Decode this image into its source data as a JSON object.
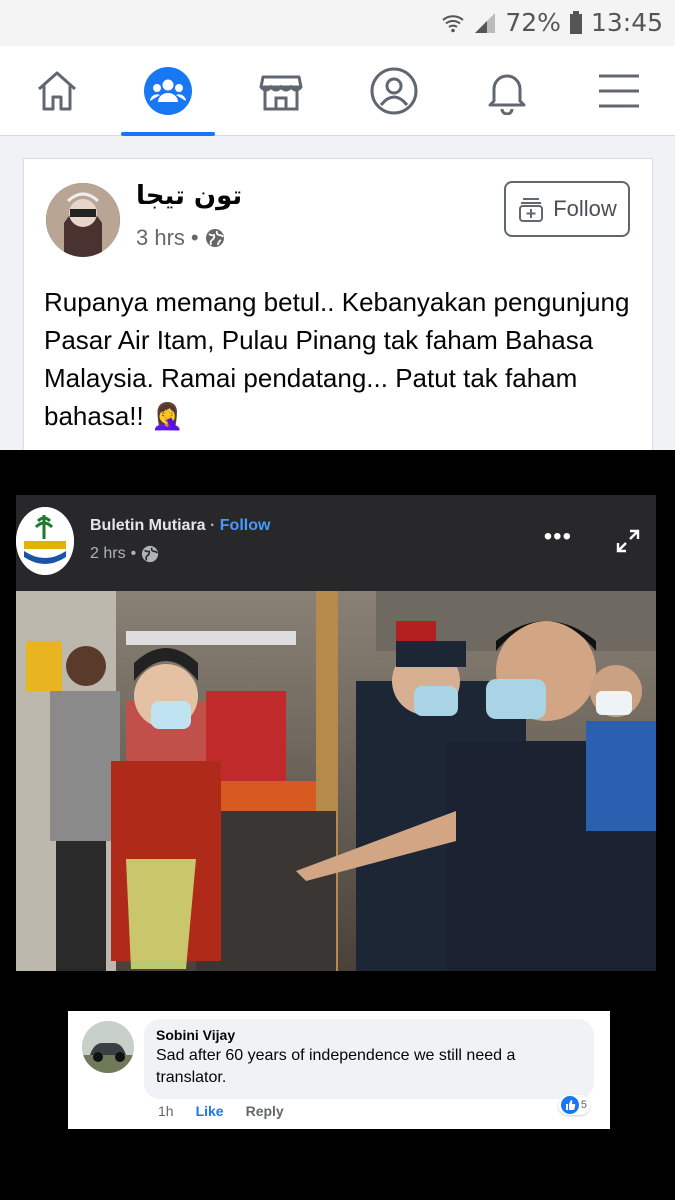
{
  "status_bar": {
    "battery": "72%",
    "time": "13:45"
  },
  "nav": {
    "items": [
      {
        "name": "home",
        "icon": "home-icon"
      },
      {
        "name": "groups",
        "icon": "groups-icon",
        "active": true
      },
      {
        "name": "marketplace",
        "icon": "marketplace-icon"
      },
      {
        "name": "profile",
        "icon": "profile-icon"
      },
      {
        "name": "notifications",
        "icon": "bell-icon"
      },
      {
        "name": "menu",
        "icon": "menu-icon"
      }
    ],
    "accent": "#1877f2"
  },
  "post": {
    "author": "تون تيجا",
    "time": "3 hrs",
    "privacy_icon": "globe-icon",
    "follow_label": "Follow",
    "text": "Rupanya memang betul.. Kebanyakan pengunjung Pasar Air Itam, Pulau Pinang tak faham Bahasa Malaysia. Ramai pendatang... Patut tak faham bahasa!! 🤦‍♀️"
  },
  "shared": {
    "page_name": "Buletin Mutiara",
    "separator": " · ",
    "follow_label": "Follow",
    "time": "2 hrs",
    "more_label": "•••"
  },
  "comment": {
    "name": "Sobini Vijay",
    "text": "Sad after 60 years of independence we still need a translator.",
    "time": "1h",
    "like_label": "Like",
    "reply_label": "Reply",
    "reaction_count": "5"
  }
}
